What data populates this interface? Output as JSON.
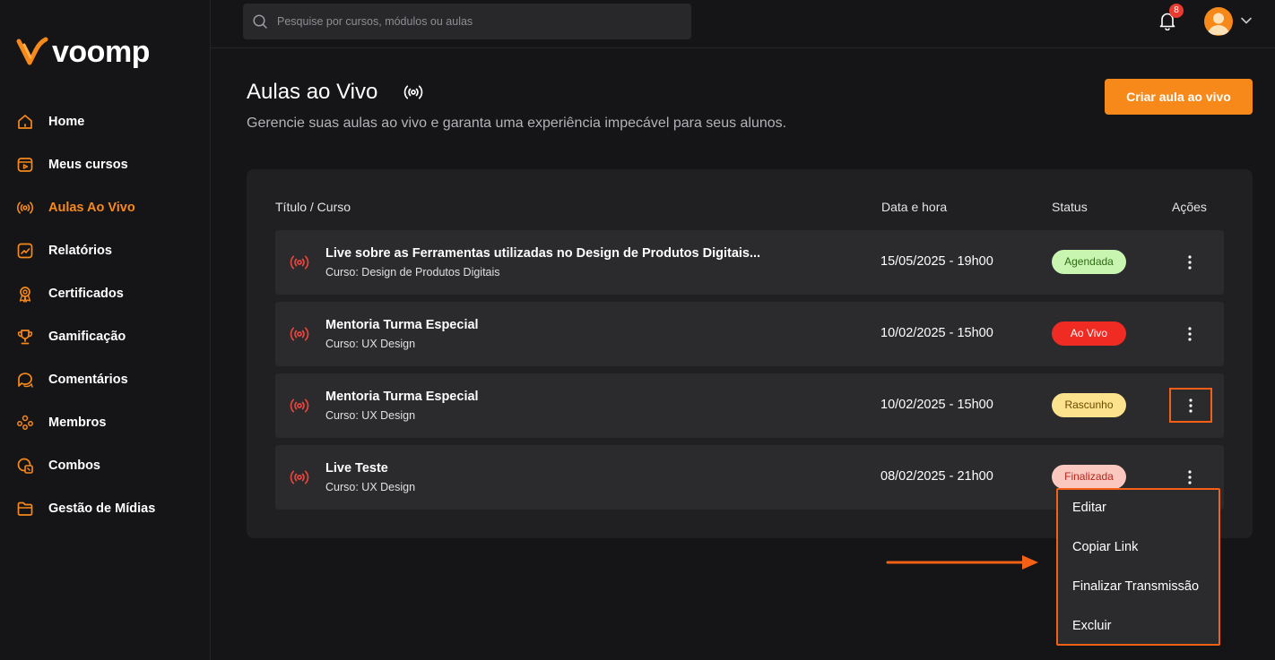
{
  "brand": {
    "name": "voomp",
    "accent": "#f7891b"
  },
  "sidebar": {
    "items": [
      {
        "label": "Home",
        "icon": "home-icon"
      },
      {
        "label": "Meus cursos",
        "icon": "courses-icon"
      },
      {
        "label": "Aulas Ao Vivo",
        "icon": "live-icon",
        "active": true
      },
      {
        "label": "Relatórios",
        "icon": "reports-icon"
      },
      {
        "label": "Certificados",
        "icon": "certificate-icon"
      },
      {
        "label": "Gamificação",
        "icon": "trophy-icon"
      },
      {
        "label": "Comentários",
        "icon": "comments-icon"
      },
      {
        "label": "Membros",
        "icon": "members-icon"
      },
      {
        "label": "Combos",
        "icon": "combos-icon"
      },
      {
        "label": "Gestão de Mídias",
        "icon": "folder-icon"
      }
    ]
  },
  "topbar": {
    "search_placeholder": "Pesquise por cursos, módulos ou aulas",
    "notifications_count": "8"
  },
  "page": {
    "title": "Aulas ao Vivo",
    "subtitle": "Gerencie suas aulas ao vivo e garanta uma experiência impecável para seus alunos.",
    "create_button": "Criar aula ao vivo"
  },
  "table": {
    "headers": {
      "title": "Título / Curso",
      "date": "Data e hora",
      "status": "Status",
      "actions": "Ações"
    },
    "rows": [
      {
        "title": "Live sobre as Ferramentas utilizadas no Design de Produtos Digitais...",
        "course": "Curso: Design de Produtos Digitais",
        "date": "15/05/2025 - 19h00",
        "status": "Agendada",
        "status_bg": "#c8f5b0",
        "status_fg": "#2f6b16"
      },
      {
        "title": "Mentoria Turma Especial",
        "course": "Curso: UX Design",
        "date": "10/02/2025 - 15h00",
        "status": "Ao Vivo",
        "status_bg": "#ef2b24",
        "status_fg": "#ffffff"
      },
      {
        "title": "Mentoria Turma Especial",
        "course": "Curso: UX Design",
        "date": "10/02/2025 - 15h00",
        "status": "Rascunho",
        "status_bg": "#fde28d",
        "status_fg": "#6b4a00"
      },
      {
        "title": "Live Teste",
        "course": "Curso: UX Design",
        "date": "08/02/2025 - 21h00",
        "status": "Finalizada",
        "status_bg": "#fbc8c0",
        "status_fg": "#b4281f"
      }
    ]
  },
  "menu": {
    "items": [
      "Editar",
      "Copiar Link",
      "Finalizar Transmissão",
      "Excluir"
    ]
  },
  "colors": {
    "live_red": "#e8453c",
    "highlight": "#f46016"
  }
}
